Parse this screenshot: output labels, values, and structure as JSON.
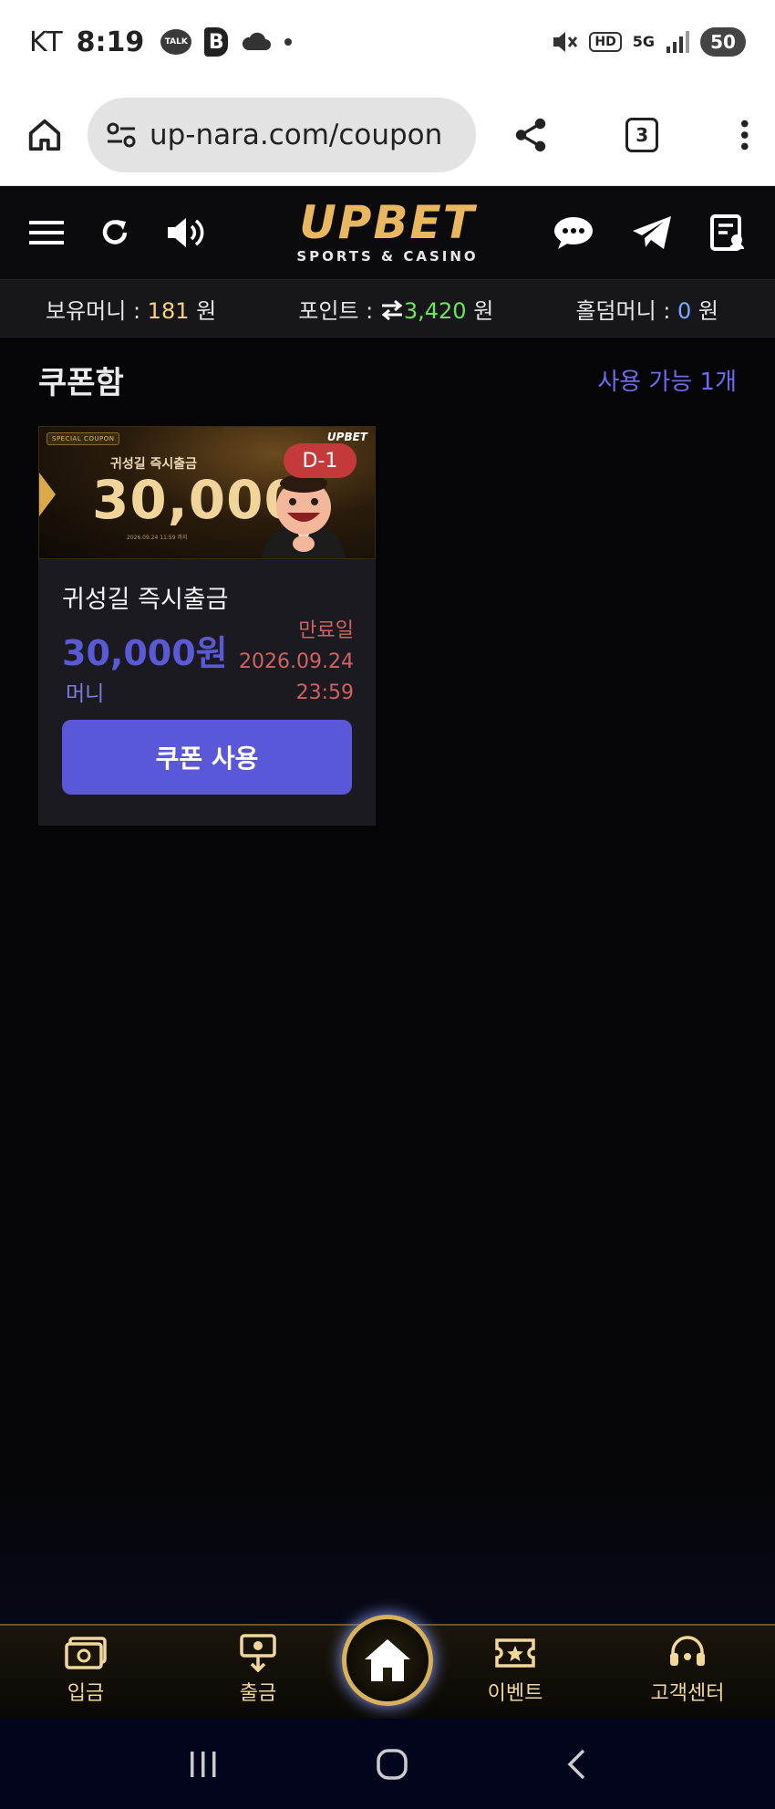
{
  "status_bar": {
    "carrier": "KT",
    "time": "8:19",
    "talk_label": "TALK",
    "b_label": "B",
    "network_label": "5G",
    "hd_label": "HD",
    "battery": "50"
  },
  "browser": {
    "url": "up-nara.com/coupon",
    "tab_count": "3"
  },
  "header": {
    "brand": "UPBET",
    "tagline": "SPORTS & CASINO"
  },
  "balance": {
    "money_label": "보유머니 : ",
    "money_value": "181",
    "money_unit": " 원",
    "point_label": "포인트 : ",
    "point_value": "3,420",
    "point_unit": " 원",
    "holdem_label": "홀덤머니 : ",
    "holdem_value": "0",
    "holdem_unit": " 원"
  },
  "coupon_box": {
    "title": "쿠폰함",
    "available": "사용 가능 1개"
  },
  "coupon": {
    "banner_special": "SPECIAL COUPON",
    "banner_logo": "UPBET",
    "banner_sub": "귀성길 즉시출금",
    "banner_amount": "30,000",
    "banner_date": "2026.09.24 11:59 까지",
    "dday": "D-1",
    "name": "귀성길 즉시출금",
    "amount": "30,000원",
    "unit": "머니",
    "expiry_label": "만료일",
    "expiry_date": "2026.09.24",
    "expiry_time": "23:59",
    "use_button": "쿠폰 사용"
  },
  "bottom_nav": {
    "deposit": "입금",
    "withdraw": "출금",
    "event": "이벤트",
    "support": "고객센터"
  },
  "colors": {
    "accent": "#5b57d9",
    "gold": "#e8b760",
    "expiry": "#d06262",
    "points": "#6ee35d"
  }
}
